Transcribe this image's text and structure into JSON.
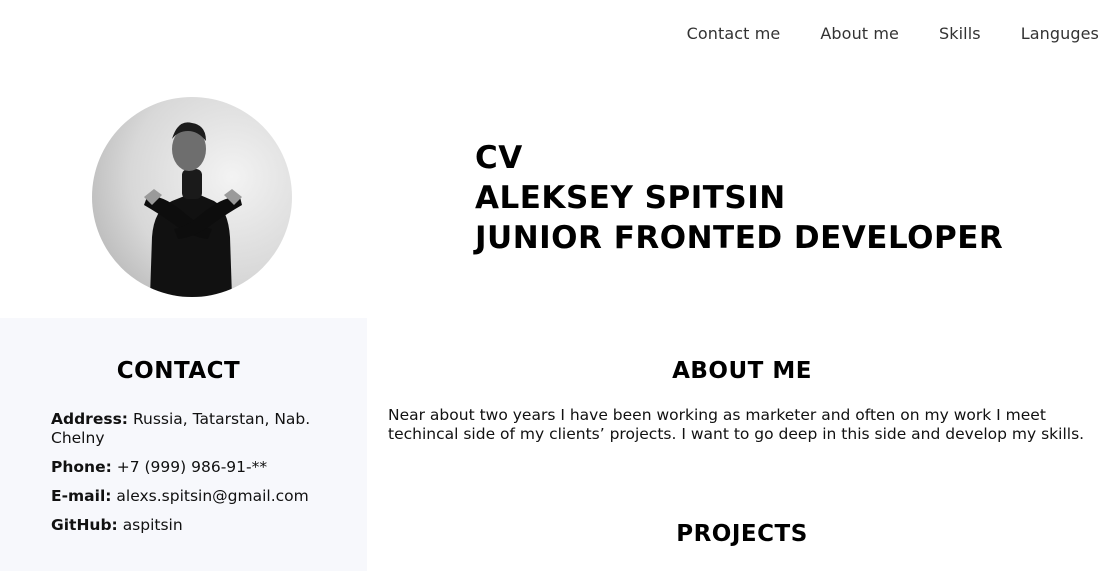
{
  "nav": {
    "items": [
      {
        "label": "Contact me"
      },
      {
        "label": "About me"
      },
      {
        "label": "Skills"
      },
      {
        "label": "Languges"
      }
    ]
  },
  "header": {
    "line1": "CV",
    "line2": "ALEKSEY SPITSIN",
    "line3": "JUNIOR FRONTED DEVELOPER"
  },
  "contact": {
    "heading": "CONTACT",
    "address_label": "Address:",
    "address_value": "Russia, Tatarstan, Nab. Chelny",
    "phone_label": "Phone:",
    "phone_value": "+7 (999) 986-91-**",
    "email_label": "E-mail:",
    "email_value": "alexs.spitsin@gmail.com",
    "github_label": "GitHub:",
    "github_value": "aspitsin"
  },
  "about": {
    "heading": "ABOUT ME",
    "text": "Near about two years I have been working as marketer and often on my work I meet techincal side of my clients’ projects. I want to go deep in this side and develop my skills."
  },
  "projects": {
    "heading": "PROJECTS"
  }
}
